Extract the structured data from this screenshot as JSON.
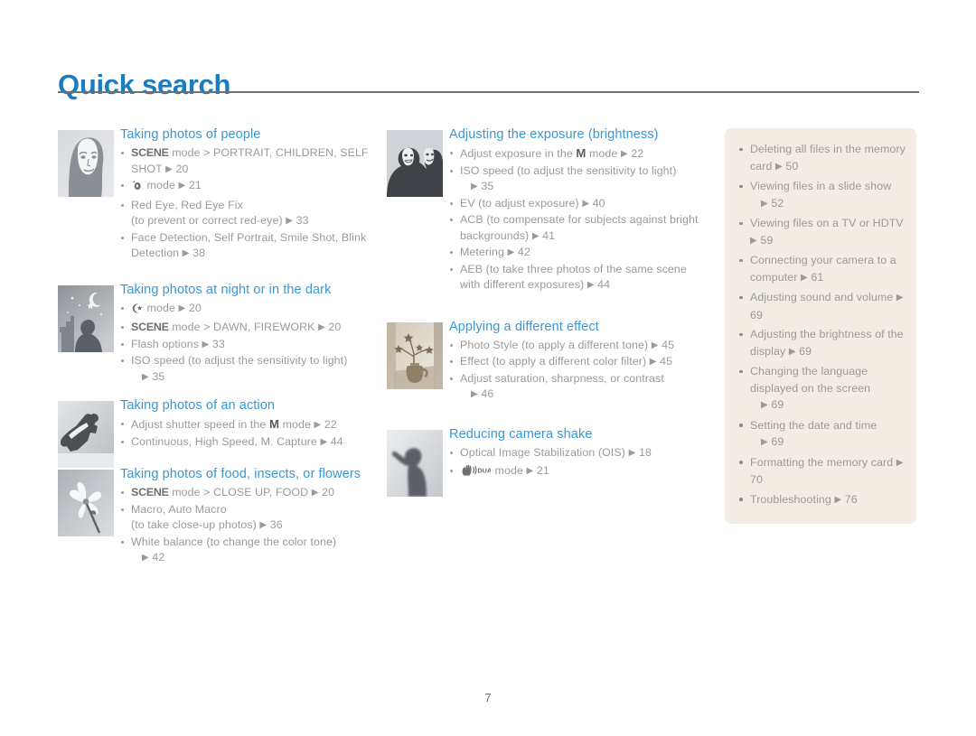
{
  "header": {
    "title": "Quick search"
  },
  "footer": {
    "page_number": "7"
  },
  "colors": {
    "title_blue": "#1b7cc0",
    "heading_blue": "#3a97d4",
    "body_gray": "#9a9a9a",
    "panel_bg": "#f2ece5",
    "rule": "#6f6f6f"
  },
  "columns": {
    "left": [
      {
        "id": "people",
        "thumb": "portrait-woman-thumbnail",
        "heading": "Taking photos of people",
        "items": [
          {
            "pre_bold": "SCENE",
            "text": " mode > PORTRAIT, CHILDREN, SELF SHOT ",
            "page": "20"
          },
          {
            "icon": "beauty-shot-icon",
            "text": " mode ",
            "page": "21"
          },
          {
            "text": "Red Eye, Red Eye Fix",
            "sub": "(to prevent or correct red-eye) ",
            "page": "33"
          },
          {
            "text": "Face Detection, Self Portrait, Smile Shot, Blink Detection ",
            "page": "38"
          }
        ]
      },
      {
        "id": "night",
        "thumb": "night-scene-thumbnail",
        "heading": "Taking photos at night or in the dark",
        "items": [
          {
            "icon": "night-mode-icon",
            "text": " mode ",
            "page": "20"
          },
          {
            "pre_bold": "SCENE",
            "text": " mode > DAWN, FIREWORK ",
            "page": "20"
          },
          {
            "text": "Flash options ",
            "page": "33"
          },
          {
            "text": "ISO speed (to adjust the sensitivity to light)",
            "indent_page": "35"
          }
        ]
      },
      {
        "id": "action",
        "thumb": "snowboarder-thumbnail",
        "heading": "Taking photos of an action",
        "items": [
          {
            "text": "Adjust shutter speed in the ",
            "mid_bold": "M",
            "text2": " mode ",
            "page": "22"
          },
          {
            "text": "Continuous, High Speed, M. Capture ",
            "page": "44"
          }
        ]
      },
      {
        "id": "macro",
        "thumb": "flower-thumbnail",
        "heading": "Taking photos of food, insects, or flowers",
        "items": [
          {
            "pre_bold": "SCENE",
            "text": " mode > CLOSE UP, FOOD ",
            "page": "20"
          },
          {
            "text": "Macro, Auto Macro",
            "sub": "(to take close-up photos) ",
            "page": "36"
          },
          {
            "text": "White balance (to change the color tone)",
            "indent_page": "42"
          }
        ]
      }
    ],
    "middle": [
      {
        "id": "exposure",
        "thumb": "two-people-thumbnail",
        "heading": "Adjusting the exposure (brightness)",
        "items": [
          {
            "text": "Adjust exposure in the ",
            "mid_bold": "M",
            "text2": " mode ",
            "page": "22"
          },
          {
            "text": "ISO speed (to adjust the sensitivity to light)",
            "indent_page": "35"
          },
          {
            "text": "EV (to adjust exposure) ",
            "page": "40"
          },
          {
            "text": "ACB (to compensate for subjects against bright backgrounds) ",
            "page": "41"
          },
          {
            "text": "Metering ",
            "page": "42"
          },
          {
            "text": "AEB (to take three photos of the same scene with different exposures) ",
            "page": "44"
          }
        ]
      },
      {
        "id": "effect",
        "thumb": "vase-flowers-thumbnail",
        "heading": "Applying a different effect",
        "items": [
          {
            "text": "Photo Style (to apply a different tone) ",
            "page": "45"
          },
          {
            "text": "Effect (to apply a different color filter) ",
            "page": "45"
          },
          {
            "text": "Adjust saturation, sharpness, or contrast",
            "indent_page": "46"
          }
        ]
      },
      {
        "id": "shake",
        "thumb": "camera-shake-thumbnail",
        "heading": "Reducing camera shake",
        "items": [
          {
            "text": "Optical Image Stabilization (OIS) ",
            "page": "18"
          },
          {
            "icon": "dual-is-icon",
            "text": " mode ",
            "page": "21"
          }
        ]
      }
    ],
    "right_panel": [
      {
        "text": "Deleting all files in the memory card ",
        "page": "50"
      },
      {
        "text": "Viewing files in a slide show",
        "indent_page": "52"
      },
      {
        "text": "Viewing files on a TV or HDTV ",
        "page": "59"
      },
      {
        "text": "Connecting your camera to a computer ",
        "page": "61"
      },
      {
        "text": "Adjusting sound and volume ",
        "page": "69"
      },
      {
        "text": "Adjusting the brightness of the display ",
        "page": "69"
      },
      {
        "text": "Changing the language displayed on the screen",
        "indent_page": "69"
      },
      {
        "text": "Setting the date and time",
        "indent_page": "69"
      },
      {
        "text": "Formatting the memory card ",
        "page": "70"
      },
      {
        "text": "Troubleshooting ",
        "page": "76"
      }
    ]
  }
}
